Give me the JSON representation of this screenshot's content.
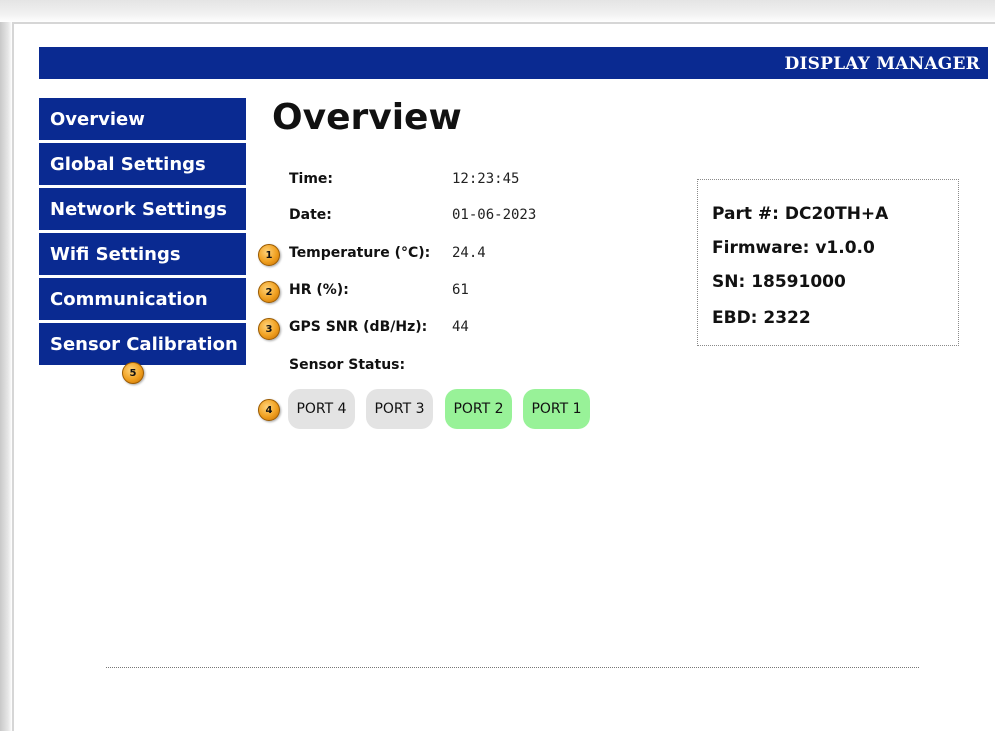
{
  "header": {
    "title": "DISPLAY MANAGER"
  },
  "sidebar": {
    "items": [
      {
        "label": "Overview"
      },
      {
        "label": "Global Settings"
      },
      {
        "label": "Network Settings"
      },
      {
        "label": "Wifi Settings"
      },
      {
        "label": "Communication"
      },
      {
        "label": "Sensor Calibration"
      }
    ]
  },
  "main": {
    "title": "Overview",
    "fields": [
      {
        "label": "Time:",
        "value": "12:23:45"
      },
      {
        "label": "Date:",
        "value": "01-06-2023"
      },
      {
        "label": "Temperature (°C):",
        "value": "24.4"
      },
      {
        "label": "HR (%):",
        "value": "61"
      },
      {
        "label": "GPS SNR (dB/Hz):",
        "value": "44"
      }
    ],
    "sensor_status_label": "Sensor Status:",
    "ports": [
      {
        "label": "PORT 4",
        "status": "inactive",
        "color": "#e3e3e3"
      },
      {
        "label": "PORT 3",
        "status": "inactive",
        "color": "#e3e3e3"
      },
      {
        "label": "PORT 2",
        "status": "active",
        "color": "#98f298"
      },
      {
        "label": "PORT 1",
        "status": "active",
        "color": "#98f298"
      }
    ]
  },
  "info_box": {
    "part": "Part #:  DC20TH+A",
    "firmware": "Firmware:  v1.0.0",
    "sn": "SN: 18591000",
    "ebd": "EBD: 2322"
  },
  "annotations": [
    "1",
    "2",
    "3",
    "4",
    "5"
  ],
  "colors": {
    "header_bg": "#0a2a91",
    "nav_bg": "#0a2a91",
    "port_inactive": "#e3e3e3",
    "port_active": "#98f298",
    "badge": "#f0a020"
  }
}
